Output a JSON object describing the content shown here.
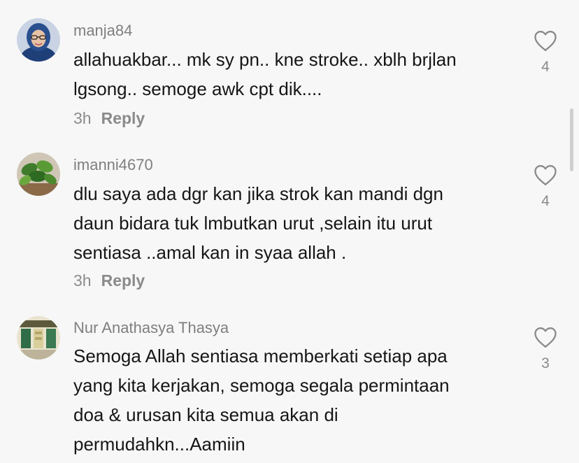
{
  "comments": [
    {
      "username": "manja84",
      "lines": [
        "allahuakbar... mk sy pn.. kne stroke.. xblh brjlan",
        "lgsong.. semoge awk cpt dik...."
      ],
      "time": "3h",
      "reply": "Reply",
      "likes": "4",
      "avatar_icon": "user-avatar-hijab"
    },
    {
      "username": "imanni4670",
      "lines": [
        "dlu saya ada dgr kan jika strok kan mandi dgn",
        "daun bidara tuk lmbutkan urut ,selain itu urut",
        "sentiasa ..amal kan in syaa allah ."
      ],
      "time": "3h",
      "reply": "Reply",
      "likes": "4",
      "avatar_icon": "user-avatar-plant"
    },
    {
      "username": "Nur Anathasya Thasya",
      "lines": [
        "Semoga Allah sentiasa memberkati setiap apa",
        "yang kita kerjakan, semoga segala permintaan",
        "doa & urusan kita semua akan di",
        "permudahkn...Aamiin"
      ],
      "likes": "3",
      "avatar_icon": "user-avatar-shop"
    }
  ],
  "icons": {
    "like": "heart-outline-icon"
  },
  "colors": {
    "background": "#f7f7f7",
    "text": "#161616",
    "muted": "#8a8a8a"
  }
}
